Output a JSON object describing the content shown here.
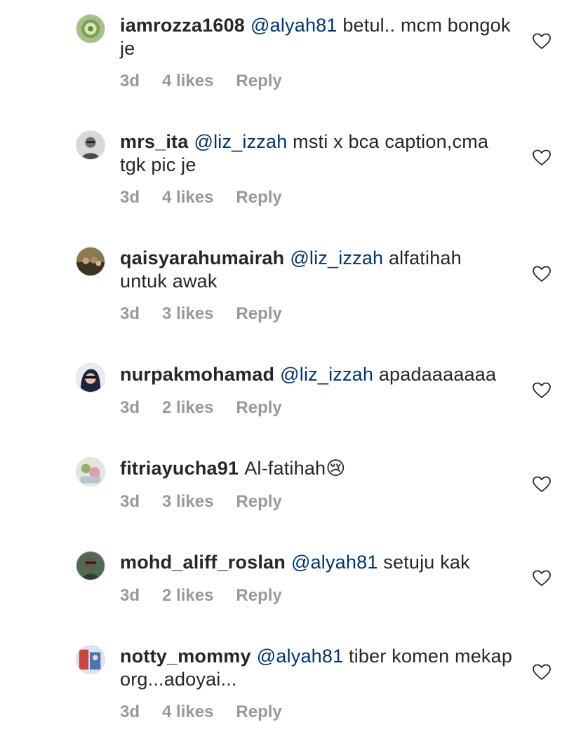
{
  "comments": [
    {
      "username": "iamrozza1608",
      "mention": "@alyah81",
      "text": "betul.. mcm bongok je",
      "time": "3d",
      "likes": "4 likes",
      "reply": "Reply",
      "avatar": "avatar-photo"
    },
    {
      "username": "mrs_ita",
      "mention": "@liz_izzah",
      "text": "msti x bca caption,cma tgk pic je",
      "time": "3d",
      "likes": "4 likes",
      "reply": "Reply",
      "avatar": "avatar-photo"
    },
    {
      "username": "qaisyarahumairah",
      "mention": "@liz_izzah",
      "text": "alfatihah untuk awak",
      "time": "3d",
      "likes": "3 likes",
      "reply": "Reply",
      "avatar": "avatar-photo"
    },
    {
      "username": "nurpakmohamad",
      "mention": "@liz_izzah",
      "text": "apadaaaaaaa",
      "time": "3d",
      "likes": "2 likes",
      "reply": "Reply",
      "avatar": "avatar-photo"
    },
    {
      "username": "fitriayucha91",
      "mention": "",
      "text": "Al-fatihah😢",
      "time": "3d",
      "likes": "3 likes",
      "reply": "Reply",
      "avatar": "avatar-photo"
    },
    {
      "username": "mohd_aliff_roslan",
      "mention": "@alyah81",
      "text": "setuju kak",
      "time": "3d",
      "likes": "2 likes",
      "reply": "Reply",
      "avatar": "avatar-photo"
    },
    {
      "username": "notty_mommy",
      "mention": "@alyah81",
      "text": "tiber komen mekap org...adoyai...",
      "time": "3d",
      "likes": "4 likes",
      "reply": "Reply",
      "avatar": "avatar-photo"
    }
  ],
  "icons": {
    "like": "heart-outline-icon"
  },
  "colors": {
    "mention": "#003569",
    "meta": "#999999",
    "text": "#262626"
  }
}
